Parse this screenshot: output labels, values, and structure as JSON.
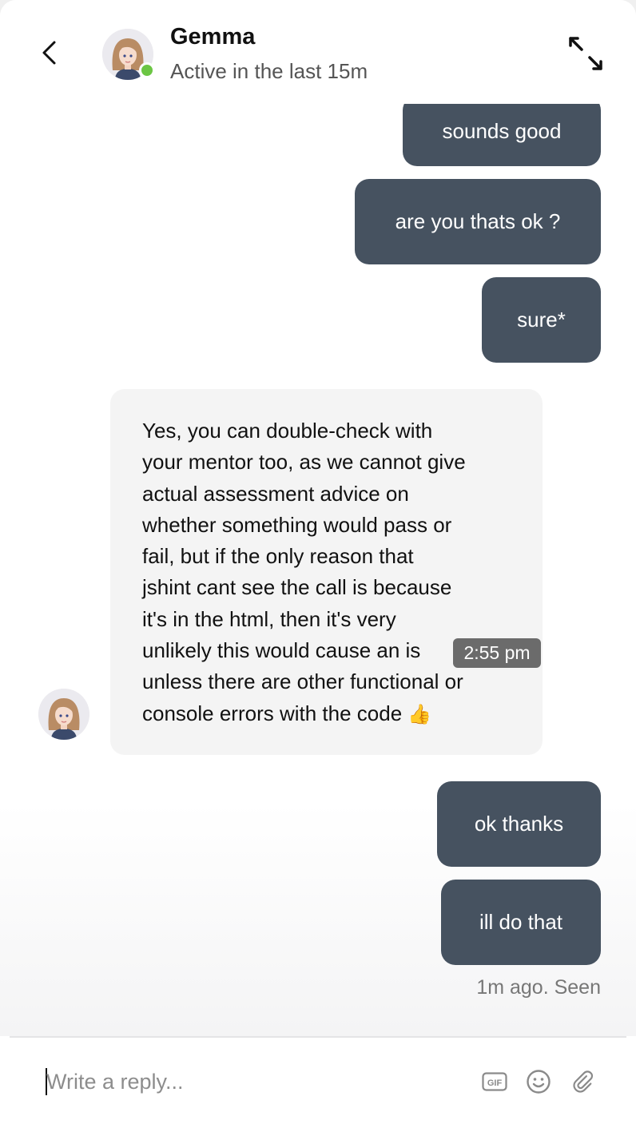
{
  "header": {
    "contact_name": "Gemma",
    "status_text": "Active in the last 15m",
    "icons": {
      "back": "chevron-left-icon",
      "expand": "expand-arrows-icon",
      "online": "online-dot"
    }
  },
  "messages": [
    {
      "direction": "out",
      "text": "sounds good"
    },
    {
      "direction": "out",
      "text": "are you thats ok ?"
    },
    {
      "direction": "out",
      "text": "sure*"
    },
    {
      "direction": "in",
      "lines": [
        "Yes, you can double-check with",
        "your mentor too, as we cannot give",
        "actual assessment advice on",
        "whether something would pass or",
        "fail, but if the only reason that",
        "jshint cant see the call is because",
        "it's in the html, then it's very",
        "unlikely this would cause an is",
        "unless there are other functional or",
        "console errors with the code"
      ],
      "emoji": "👍",
      "tooltip_time": "2:55 pm"
    },
    {
      "direction": "out",
      "text": "ok thanks"
    },
    {
      "direction": "out",
      "text": "ill do that"
    }
  ],
  "seen_status": "1m ago. Seen",
  "composer": {
    "placeholder": "Write a reply...",
    "gif_label": "GIF",
    "icons": [
      "gif-icon",
      "emoji-icon",
      "paperclip-icon"
    ]
  },
  "colors": {
    "outgoing_bubble": "#465260",
    "incoming_bubble": "#f4f4f4",
    "online": "#6cc644",
    "tooltip": "#6b6b6b"
  }
}
